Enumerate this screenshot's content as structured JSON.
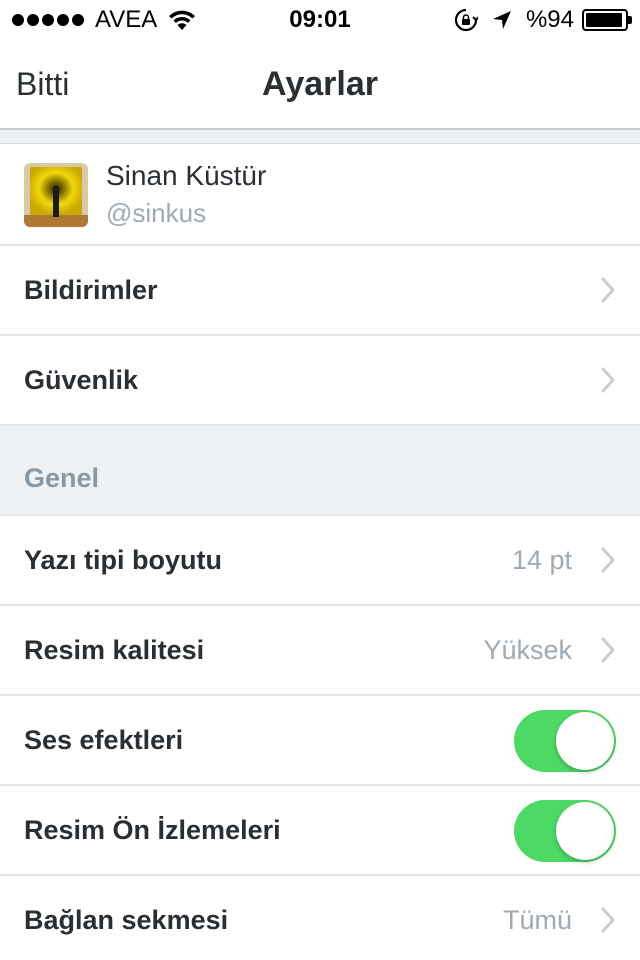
{
  "status_bar": {
    "carrier": "AVEA",
    "time": "09:01",
    "battery_percent": "%94",
    "battery_level": 0.94
  },
  "nav": {
    "done_label": "Bitti",
    "title": "Ayarlar"
  },
  "profile": {
    "name": "Sinan Küstür",
    "handle": "@sinkus"
  },
  "rows_top": [
    {
      "label": "Bildirimler"
    },
    {
      "label": "Güvenlik"
    }
  ],
  "section_general": {
    "label": "Genel"
  },
  "rows_general": {
    "font_size": {
      "label": "Yazı tipi boyutu",
      "value": "14 pt"
    },
    "image_quality": {
      "label": "Resim kalitesi",
      "value": "Yüksek"
    },
    "sound_effects": {
      "label": "Ses efektleri",
      "enabled": true
    },
    "image_previews": {
      "label": "Resim Ön İzlemeleri",
      "enabled": true
    },
    "connect_tab": {
      "label": "Bağlan sekmesi",
      "value": "Tümü"
    }
  },
  "colors": {
    "toggle_on": "#4cd964",
    "secondary_text": "#a0aab2",
    "section_bg": "#eef2f5"
  }
}
